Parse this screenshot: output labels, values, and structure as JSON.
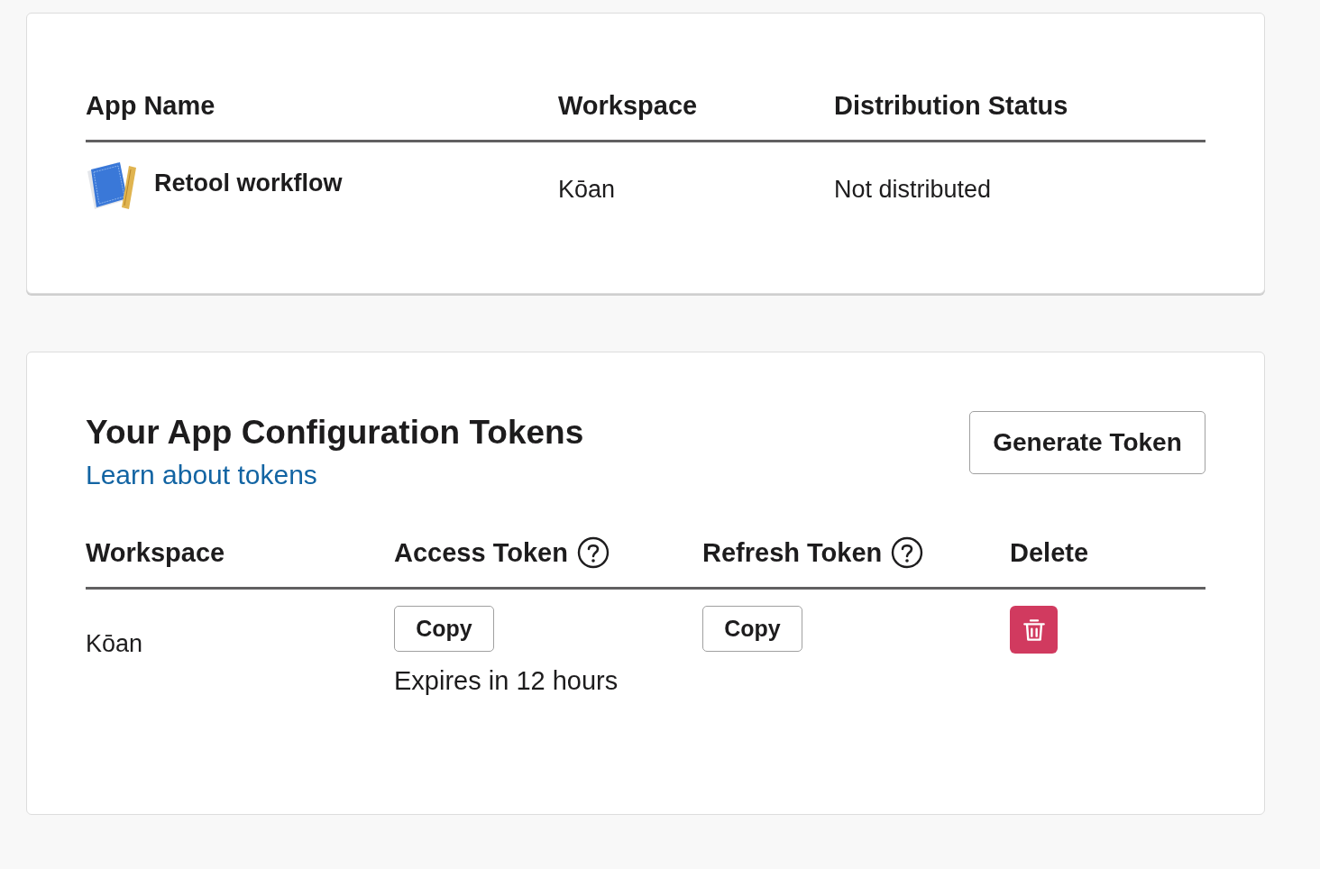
{
  "apps_table": {
    "columns": [
      "App Name",
      "Workspace",
      "Distribution Status"
    ],
    "rows": [
      {
        "app_name": "Retool workflow",
        "workspace": "Kōan",
        "distribution_status": "Not distributed"
      }
    ]
  },
  "tokens": {
    "title": "Your App Configuration Tokens",
    "link": "Learn about tokens",
    "generate_button": "Generate Token",
    "columns": [
      {
        "label": "Workspace",
        "help": false
      },
      {
        "label": "Access Token",
        "help": true
      },
      {
        "label": "Refresh Token",
        "help": true
      },
      {
        "label": "Delete",
        "help": false
      }
    ],
    "rows": [
      {
        "workspace": "Kōan",
        "access_button": "Copy",
        "expiry": "Expires in 12 hours",
        "refresh_button": "Copy"
      }
    ]
  }
}
